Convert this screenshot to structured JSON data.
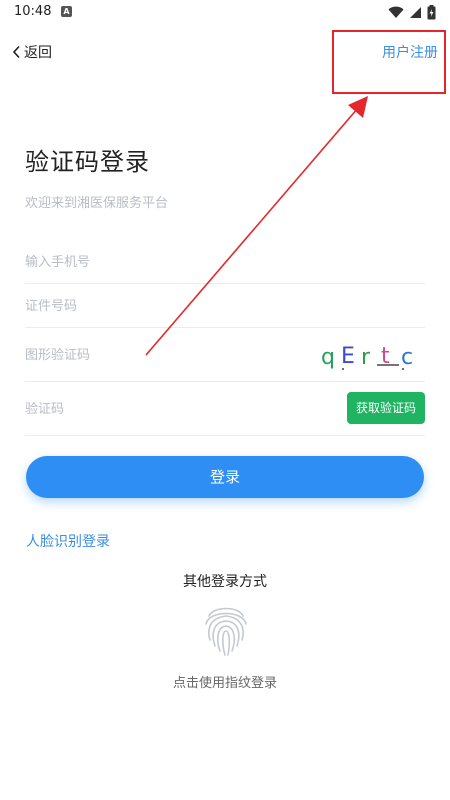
{
  "status_bar": {
    "time": "10:48",
    "notification_icon": "A",
    "icons": [
      "wifi-icon",
      "cell-signal-icon",
      "battery-icon"
    ]
  },
  "header": {
    "back_label": "返回",
    "register_label": "用户注册"
  },
  "title": "验证码登录",
  "subtitle": "欢迎来到湘医保服务平台",
  "form": {
    "phone_placeholder": "输入手机号",
    "id_placeholder": "证件号码",
    "captcha_placeholder": "图形验证码",
    "captcha_text": "qErtc",
    "sms_placeholder": "验证码",
    "sms_button_label": "获取验证码"
  },
  "login_button_label": "登录",
  "face_login_label": "人脸识别登录",
  "other_methods_label": "其他登录方式",
  "fingerprint_label": "点击使用指纹登录",
  "colors": {
    "primary": "#2f8ef4",
    "link": "#3a8ee6",
    "sms_button": "#1fb461",
    "annotation": "#e5262a"
  }
}
